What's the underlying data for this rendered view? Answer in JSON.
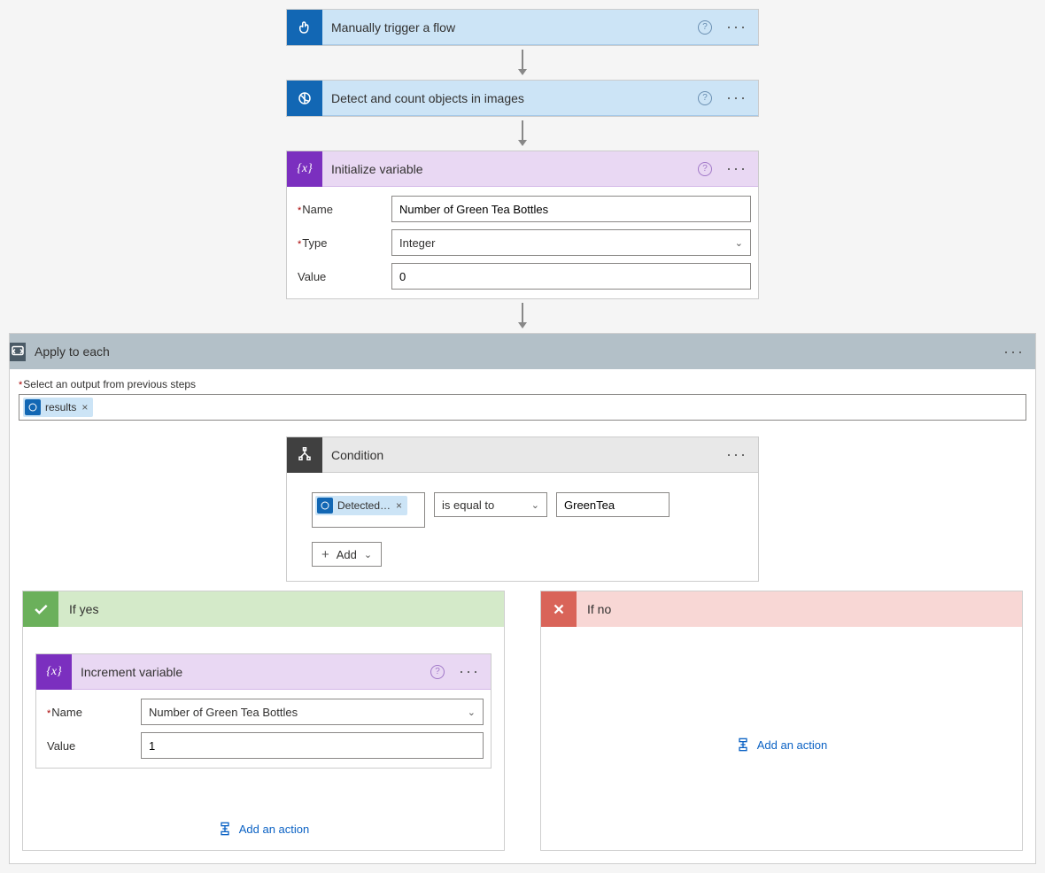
{
  "steps": {
    "trigger": {
      "title": "Manually trigger a flow"
    },
    "detect": {
      "title": "Detect and count objects in images"
    },
    "init_var": {
      "title": "Initialize variable",
      "name_label": "Name",
      "type_label": "Type",
      "value_label": "Value",
      "name_value": "Number of Green Tea Bottles",
      "type_value": "Integer",
      "value_value": "0"
    },
    "apply": {
      "title": "Apply to each",
      "select_label": "Select an output from previous steps",
      "token": "results"
    },
    "condition": {
      "title": "Condition",
      "left_token": "Detected…",
      "operator": "is equal to",
      "right_value": "GreenTea",
      "add_label": "Add"
    },
    "if_yes": {
      "title": "If yes"
    },
    "if_no": {
      "title": "If no"
    },
    "inc_var": {
      "title": "Increment variable",
      "name_label": "Name",
      "value_label": "Value",
      "name_value": "Number of Green Tea Bottles",
      "value_value": "1"
    },
    "add_action": "Add an action"
  },
  "icons": {
    "more": "···",
    "help": "?",
    "close": "×",
    "plus": "+"
  }
}
